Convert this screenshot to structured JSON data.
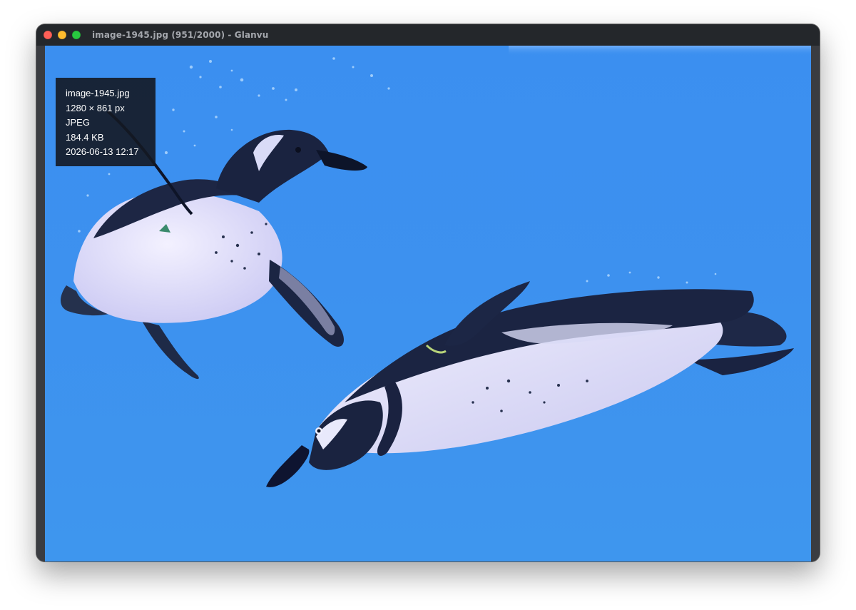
{
  "window": {
    "title": "image-1945.jpg (951/2000) - Glanvu",
    "buttons": {
      "close_color": "#fe5f57",
      "minimize_color": "#febc2e",
      "maximize_color": "#28c840"
    }
  },
  "viewer": {
    "image_subject": "two penguins swimming underwater",
    "info": {
      "filename": "image-1945.jpg",
      "dimensions": "1280 × 861 px",
      "format": "JPEG",
      "size": "184.4 KB",
      "date": "2026-06-13  12:17"
    }
  },
  "colors": {
    "water": "#3d91ef",
    "titlebar": "#24272b",
    "info_bg": "#141822"
  }
}
